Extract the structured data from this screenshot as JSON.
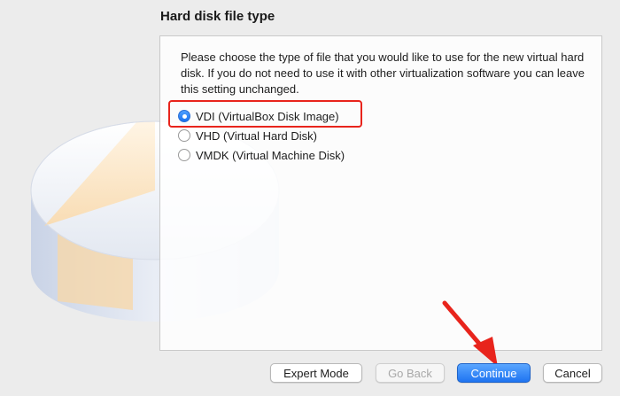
{
  "dialog": {
    "title": "Hard disk file type",
    "description": "Please choose the type of file that you would like to use for the new virtual hard disk. If you do not need to use it with other virtualization software you can leave this setting unchanged."
  },
  "options": [
    {
      "label": "VDI (VirtualBox Disk Image)",
      "selected": true
    },
    {
      "label": "VHD (Virtual Hard Disk)",
      "selected": false
    },
    {
      "label": "VMDK (Virtual Machine Disk)",
      "selected": false
    }
  ],
  "buttons": {
    "expert_mode": "Expert Mode",
    "go_back": "Go Back",
    "continue": "Continue",
    "cancel": "Cancel"
  },
  "colors": {
    "highlight": "#e8241c",
    "accent": "#1f74f1"
  }
}
